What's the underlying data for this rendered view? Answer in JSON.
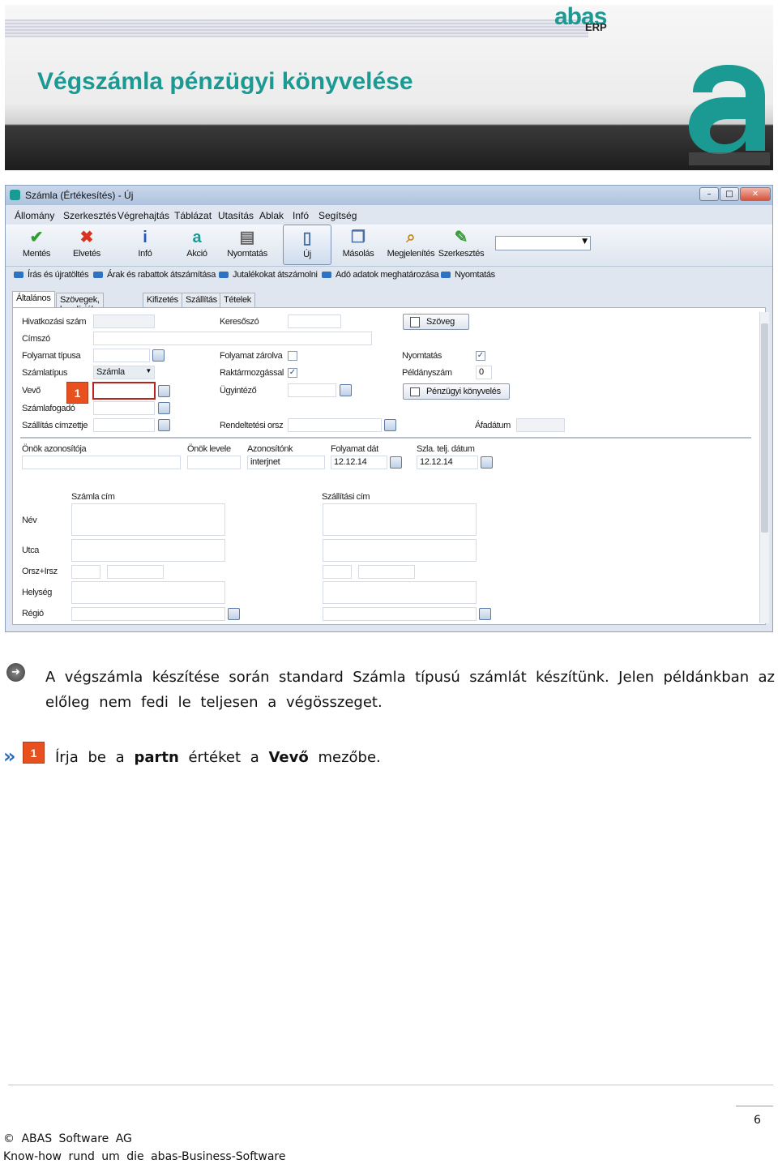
{
  "banner": {
    "title": "Végszámla pénzügyi könyvelése",
    "logo_text": "abas",
    "logo_sub": "ERP"
  },
  "window": {
    "title": "Számla (Értékesítés) - Új",
    "menu": [
      "Állomány",
      "Szerkesztés",
      "Végrehajtás",
      "Táblázat",
      "Utasítás",
      "Ablak",
      "Infó",
      "Segítség"
    ],
    "toolbar": [
      {
        "label": "Mentés",
        "icon": "checkmark-icon",
        "color": "#2f9e2f"
      },
      {
        "label": "Elvetés",
        "icon": "red-x-icon",
        "color": "#d9321f"
      },
      {
        "label": "Infó",
        "icon": "info-icon",
        "color": "#2457b8"
      },
      {
        "label": "Akció",
        "icon": "abas-action-icon",
        "color": "#1a9a93"
      },
      {
        "label": "Nyomtatás",
        "icon": "printer-icon",
        "color": "#666666"
      },
      {
        "label": "Új",
        "icon": "new-document-icon",
        "color": "#4a6fa5"
      },
      {
        "label": "Másolás",
        "icon": "copy-icon",
        "color": "#4a6fa5"
      },
      {
        "label": "Megjelenítés",
        "icon": "magnifier-icon",
        "color": "#c58a1e"
      },
      {
        "label": "Szerkesztés",
        "icon": "edit-pencil-icon",
        "color": "#3a9b3a"
      }
    ],
    "actions": [
      "Írás és újratöltés",
      "Árak és rabattok átszámítása",
      "Jutalékokat átszámolni",
      "Adó adatok meghatározása",
      "Nyomtatás"
    ],
    "tabs": [
      "Általános",
      "Szövegek, kondíciók",
      "Kifizetés",
      "Szállítás",
      "Tételek"
    ],
    "form": {
      "hivatkozasi_szam": "Hivatkozási szám",
      "cimszo": "Címszó",
      "folyamat_tipusa": "Folyamat típusa",
      "szamlatipus": "Számlatípus",
      "szamlatipus_value": "Számla",
      "vevo": "Vevő",
      "szamlafogado": "Számlafogadó",
      "szallitas_cimzettje": "Szállítás címzettje",
      "keresoszo": "Keresőszó",
      "folyamat_zarolva": "Folyamat zárolva",
      "raktarmozgassal": "Raktármozgással",
      "ugyintezo": "Ügyintéző",
      "rendeltetesi_orsz": "Rendeltetési orsz",
      "szoveg_btn": "Szöveg",
      "nyomtatas": "Nyomtatás",
      "peldanyszam": "Példányszám",
      "peldanyszam_value": "0",
      "penzugyi_btn": "Pénzügyi könyvelés",
      "afadatum": "Áfadátum",
      "onok_azonositoja": "Önök azonosítója",
      "onok_levele": "Önök levele",
      "azonositonk": "Azonosítónk",
      "azonositonk_value": "interjnet",
      "folyamat_dat": "Folyamat dát",
      "folyamat_dat_value": "12.12.14",
      "szla_telj_datum": "Szla. telj. dátum",
      "szla_telj_datum_value": "12.12.14",
      "szamla_cim": "Számla cím",
      "szallitasi_cim": "Szállítási cím",
      "nev": "Név",
      "utca": "Utca",
      "orsz_irsz": "Orsz+Irsz",
      "helyseg": "Helység",
      "regio": "Régió"
    },
    "badge": "1"
  },
  "body": {
    "para1_line1": "A végszámla készítése során standard Számla típusú számlát készítünk. Jelen példánkban az",
    "para1_line2": "előleg nem fedi le teljesen a végösszeget.",
    "step_marker": "»",
    "step_badge": "1",
    "step_pre": "Írja be a ",
    "step_bold1": "partn",
    "step_mid": " értéket a ",
    "step_bold2": "Vevő",
    "step_post": " mezőbe."
  },
  "footer": {
    "page_number": "6",
    "line1": "© ABAS Software AG",
    "line2": "Know-how rund um die abas-Business-Software"
  }
}
